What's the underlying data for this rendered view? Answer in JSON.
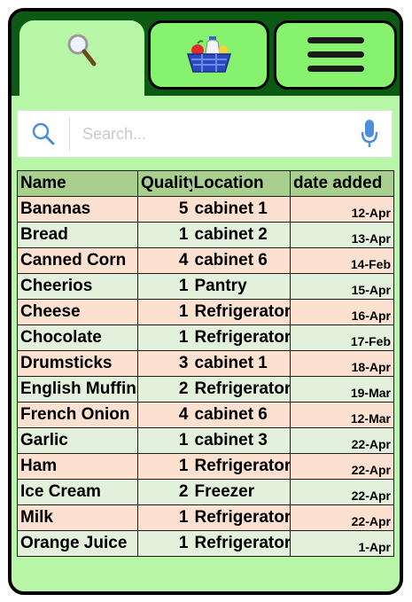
{
  "tabs": [
    {
      "id": "search",
      "icon": "magnifier-icon",
      "active": true
    },
    {
      "id": "basket",
      "icon": "grocery-basket-icon",
      "active": false
    },
    {
      "id": "menu",
      "icon": "hamburger-menu-icon",
      "active": false
    }
  ],
  "search": {
    "placeholder": "Search...",
    "value": ""
  },
  "table": {
    "headers": {
      "name": "Name",
      "quantity": "Quality",
      "location": "Location",
      "date": "date added"
    },
    "rows": [
      {
        "name": "Bananas",
        "qty": "5",
        "location": "cabinet 1",
        "date": "12-Apr"
      },
      {
        "name": "Bread",
        "qty": "1",
        "location": "cabinet 2",
        "date": "13-Apr"
      },
      {
        "name": "Canned Corn",
        "qty": "4",
        "location": "cabinet 6",
        "date": "14-Feb"
      },
      {
        "name": "Cheerios",
        "qty": "1",
        "location": "Pantry",
        "date": "15-Apr"
      },
      {
        "name": "Cheese",
        "qty": "1",
        "location": "Refrigerator",
        "date": "16-Apr"
      },
      {
        "name": "Chocolate",
        "qty": "1",
        "location": "Refrigerator",
        "date": "17-Feb"
      },
      {
        "name": "Drumsticks",
        "qty": "3",
        "location": "cabinet 1",
        "date": "18-Apr"
      },
      {
        "name": "English Muffins",
        "qty": "2",
        "location": "Refrigerator",
        "date": "19-Mar"
      },
      {
        "name": "French Onion",
        "qty": "4",
        "location": "cabinet 6",
        "date": "12-Mar"
      },
      {
        "name": "Garlic",
        "qty": "1",
        "location": "cabinet 3",
        "date": "22-Apr"
      },
      {
        "name": "Ham",
        "qty": "1",
        "location": "Refrigerator",
        "date": "22-Apr"
      },
      {
        "name": "Ice Cream",
        "qty": "2",
        "location": "Freezer",
        "date": "22-Apr"
      },
      {
        "name": "Milk",
        "qty": "1",
        "location": "Refrigerator",
        "date": "22-Apr"
      },
      {
        "name": "Orange Juice",
        "qty": "1",
        "location": "Refrigerator",
        "date": "1-Apr"
      }
    ]
  },
  "colors": {
    "header_row": "#a8cf8d",
    "row_odd": "#fce0d0",
    "row_even": "#e3f0dc",
    "tabbar": "#0b5a13",
    "tab": "#86f26e",
    "panel": "#b7f7a7"
  }
}
